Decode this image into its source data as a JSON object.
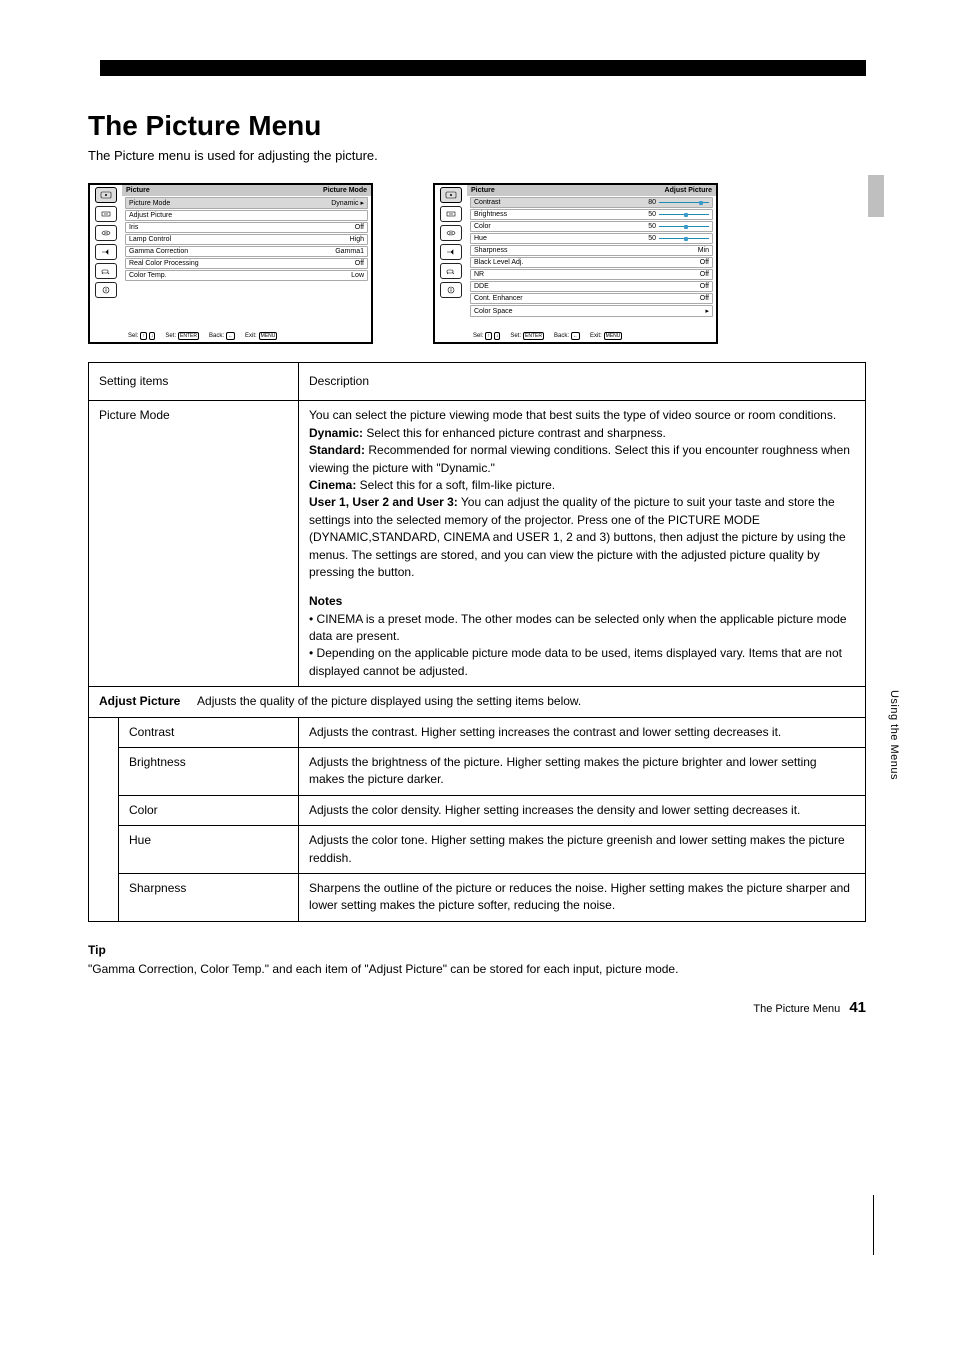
{
  "heading": "The Picture Menu",
  "subtitle": "The Picture menu is used for adjusting the picture.",
  "side_label": "Using the Menus",
  "page_number_label": "The Picture Menu",
  "page_number": "41",
  "left_panel": {
    "title": "Picture",
    "category": "Picture Mode",
    "rows": [
      {
        "label": "Picture Mode",
        "value": "Dynamic",
        "arrow": true,
        "hl": true
      },
      {
        "label": "Adjust Picture",
        "value": ""
      },
      {
        "label": "Iris",
        "value": "Off"
      },
      {
        "label": "Lamp Control",
        "value": "High"
      },
      {
        "label": "Gamma Correction",
        "value": "Gamma1"
      },
      {
        "label": "Real Color Processing",
        "value": "Off"
      },
      {
        "label": "Color Temp.",
        "value": "Low"
      }
    ]
  },
  "right_panel": {
    "title": "Picture",
    "category": "Adjust Picture",
    "rows": [
      {
        "label": "Contrast",
        "value": "80",
        "slider": true,
        "pos": 80
      },
      {
        "label": "Brightness",
        "value": "50",
        "slider": true,
        "pos": 50
      },
      {
        "label": "Color",
        "value": "50",
        "slider": true,
        "pos": 50
      },
      {
        "label": "Hue",
        "value": "50",
        "slider": true,
        "pos": 50
      },
      {
        "label": "Sharpness",
        "value": "Min",
        "slider": false
      },
      {
        "label": "Black Level Adj.",
        "value": "Off"
      },
      {
        "label": "NR",
        "value": "Off"
      },
      {
        "label": "DDE",
        "value": "Off"
      },
      {
        "label": "Cont. Enhancer",
        "value": "Off"
      },
      {
        "label": "Color Space",
        "value": "",
        "arrow": true
      }
    ]
  },
  "legend": {
    "sel": "Sel:",
    "set": "Set:",
    "back": "Back:",
    "exit": "Exit:",
    "enter": "ENTER",
    "menu": "MENU"
  },
  "table_header": {
    "item": "Setting items",
    "desc": "Description"
  },
  "picture_mode": {
    "label": "Picture Mode",
    "intro": "You can select the picture viewing mode that best suits the type of video source or room conditions.",
    "dynamic": {
      "name": "Dynamic:",
      "desc": " Select this for enhanced picture contrast and sharpness."
    },
    "standard": {
      "name": "Standard:",
      "desc": " Recommended for normal viewing conditions. Select this if you encounter roughness when viewing the picture with \"Dynamic.\""
    },
    "cinema": {
      "name": "Cinema:",
      "desc": " Select this for a soft, film-like picture."
    },
    "user": {
      "name": "User 1, User 2 and User 3:",
      "desc": " You can adjust the quality of the picture to suit your taste and store the settings into the selected memory of the projector. Press one of the PICTURE MODE (DYNAMIC,STANDARD, CINEMA and USER 1, 2 and 3) buttons, then adjust the picture by using the menus. The settings are stored, and you can view the picture with the adjusted picture quality by pressing the button."
    },
    "note_label": "Notes",
    "note1": "• CINEMA is a preset mode. The other modes can be selected only when the applicable picture mode data are present.",
    "note2": "• Depending on the applicable picture mode data to be used, items displayed vary. Items that are not displayed cannot be adjusted."
  },
  "adjust": {
    "label": "Adjust Picture",
    "desc": "Adjusts the quality of the picture displayed using the setting items below.",
    "rows": [
      {
        "name": "Contrast",
        "desc": "Adjusts the contrast. Higher setting increases the contrast and lower setting decreases it."
      },
      {
        "name": "Brightness",
        "desc": "Adjusts the brightness of the picture. Higher setting makes the picture brighter and lower setting makes the picture darker."
      },
      {
        "name": "Color",
        "desc": "Adjusts the color density. Higher setting increases the density and lower setting decreases it."
      },
      {
        "name": "Hue",
        "desc": "Adjusts the color tone. Higher setting makes the picture greenish and lower setting makes the picture reddish."
      },
      {
        "name": "Sharpness",
        "desc": "Sharpens the outline of the picture or reduces the noise. Higher setting makes the picture sharper and lower setting makes the picture softer, reducing the noise."
      }
    ]
  },
  "tip": {
    "title": "Tip",
    "body": "\"Gamma Correction, Color Temp.\" and each item of \"Adjust Picture\" can be stored for each input, picture mode."
  }
}
